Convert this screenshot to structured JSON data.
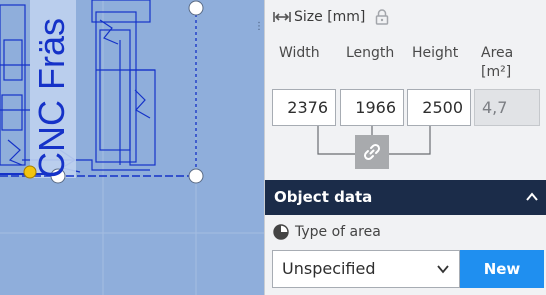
{
  "canvas": {
    "vertical_label": "CNC Fräs"
  },
  "panel": {
    "size_title": "Size [mm]",
    "columns": {
      "width": "Width",
      "length": "Length",
      "height": "Height",
      "area": "Area",
      "area_unit": "[m²]"
    },
    "values": {
      "width": "2376",
      "length": "1966",
      "height": "2500",
      "area": "4,7"
    },
    "object_data": {
      "header": "Object data",
      "type_label": "Type of area",
      "type_value": "Unspecified",
      "new_button": "New"
    }
  },
  "colors": {
    "canvas_bg": "#8faedb",
    "drawing_lines": "#1532c8",
    "header_bg": "#1b2c49",
    "accent": "#1f8ff0",
    "handle_yellow": "#f2c40f"
  },
  "icons": [
    "resize-horizontal-icon",
    "lock-icon",
    "link-icon",
    "chevron-up-icon",
    "pie-chart-icon",
    "chevron-down-icon"
  ]
}
